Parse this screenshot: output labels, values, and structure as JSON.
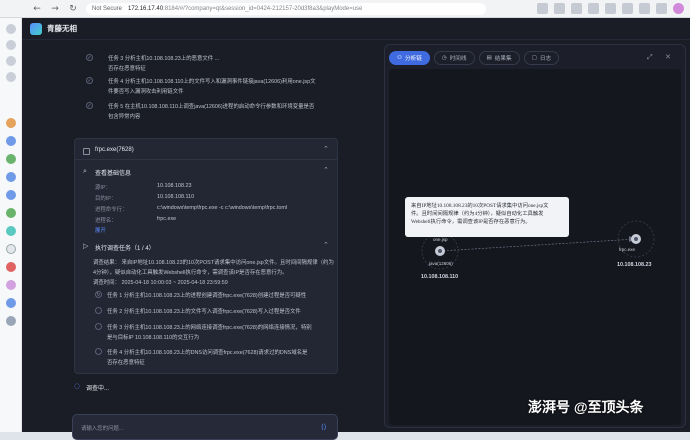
{
  "browser": {
    "security": "Not Secure",
    "host": "172.16.17.40",
    "path": ":8184/#/?company=qt&session_id=0424-212157-20d3f8a3&playMode=use"
  },
  "app": {
    "name": "青藤无相"
  },
  "chat": {
    "prev_tasks": [
      "任务 3 分析主机10.108.108.23上的恶意文件 ...",
      "否存在恶意特征",
      "任务 4 分析主机10.108.108.110上的文件写入和漏洞事件链接java(12606)利用one.jsp文",
      "件要否写入漏洞攻击利用链文件",
      "任务 5 在主机10.108.108.110上调查java(12606)进程的启动命令行参数和环境变量是否",
      "包含异常内容"
    ],
    "card_title": "frpc.exe(7628)",
    "basic_info_title": "查看基础信息",
    "info_rows": [
      {
        "label": "源IP：",
        "value": "10.108.108.23"
      },
      {
        "label": "目的IP：",
        "value": "10.108.108.110"
      },
      {
        "label": "进程命令行：",
        "value": "c:\\windows\\temp\\frpc.exe -c c:\\windows\\temp\\frpc.toml"
      },
      {
        "label": "进程名：",
        "value": "frpc.exe"
      }
    ],
    "expand_link": "展开",
    "investigation_title": "执行调查任务（1 / 4）",
    "summary_lines": [
      "调查结果： 来自IP地址10.108.108.23的10次POST请求集中访问one.jsp文件。且时间间隔规律（约为",
      "4分钟），疑似自动化工具触发Webshell执行命令，需调查该IP是否存在恶意行为。",
      "调查时间： 2025-04-18 10:00:03 ~ 2025-04-18 23:59:59"
    ],
    "tasks": [
      "任务 1 分析主机10.108.108.23上的进程创建调查frpc.exe(7628)创建过程是否可疑性",
      "任务 2 分析主机10.108.108.23上的文件写入调查frpc.exe(7628)写入过程是否文件",
      "任务 3 分析主机10.108.108.23上的网络连接调查frpc.exe(7628)的网络连接情况，特别",
      "是与目标IP 10.108.108.110的交互行为",
      "任务 4 分析主机10.108.108.23上的DNS访问调查frpc.exe(7628)请求过的DNS域名是",
      "否存在恶意特征"
    ],
    "status_text": "调查中...",
    "input_placeholder": "请输入您的问题..."
  },
  "panel": {
    "tabs": [
      {
        "label": "分析链",
        "active": true
      },
      {
        "label": "时间线",
        "active": false
      },
      {
        "label": "结果集",
        "active": false
      },
      {
        "label": "日志",
        "active": false
      }
    ],
    "tooltip_lines": [
      "来自IP地址10.108.108.23的10次POST请求集中访问one.jsp文",
      "件。且时间间隔规律（约为4分钟），疑似自动化工具触发",
      "Webshell执行命令，需调查该IP是否存在恶意行为。"
    ],
    "nodes": [
      {
        "name": "java(12606)",
        "ip": "10.108.108.110",
        "badge": "one.jsp"
      },
      {
        "name": "frpc.exe",
        "ip": "10.108.108.23",
        "badge": ""
      }
    ]
  },
  "watermark": "澎湃号 @至顶头条",
  "colors": {
    "accent": "#3f6ae0",
    "background": "#1a1d26",
    "card": "#232734"
  }
}
